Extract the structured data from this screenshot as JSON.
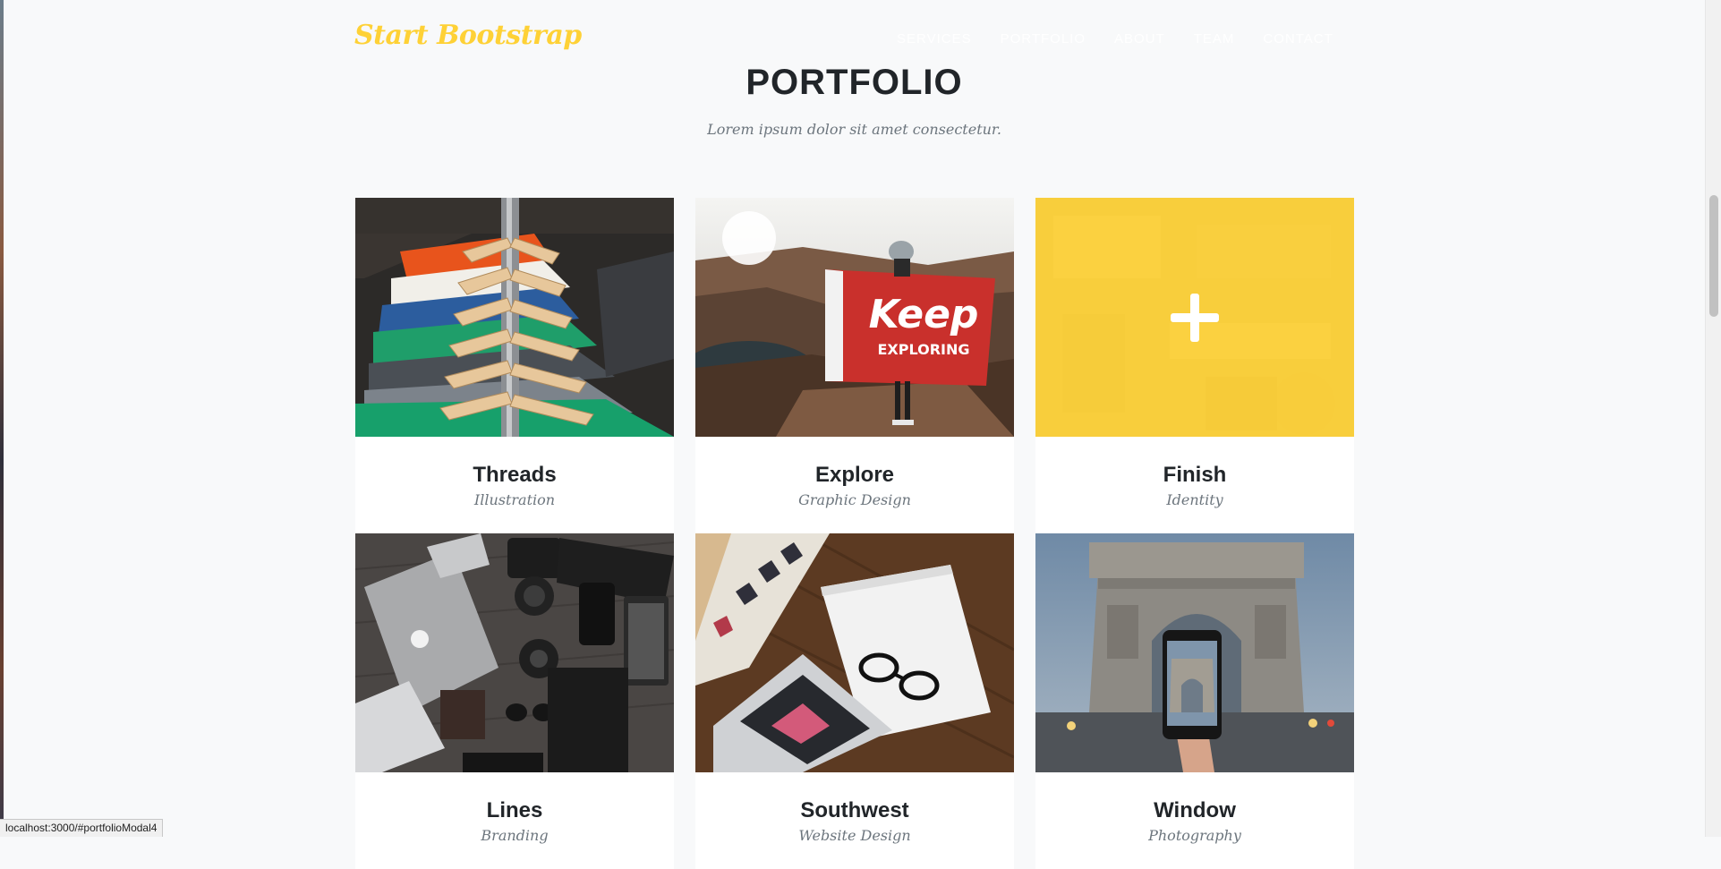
{
  "navbar": {
    "brand": "Start Bootstrap",
    "links": [
      {
        "label": "Services"
      },
      {
        "label": "Portfolio"
      },
      {
        "label": "About"
      },
      {
        "label": "Team"
      },
      {
        "label": "Contact"
      }
    ]
  },
  "portfolio": {
    "title": "PORTFOLIO",
    "subtitle": "Lorem ipsum dolor sit amet consectetur.",
    "items": [
      {
        "title": "Threads",
        "category": "Illustration",
        "image": "clothes-hangers-photo"
      },
      {
        "title": "Explore",
        "category": "Graphic Design",
        "image": "keep-exploring-flag-photo"
      },
      {
        "title": "Finish",
        "category": "Identity",
        "image": "desk-items-photo",
        "hovered": true
      },
      {
        "title": "Lines",
        "category": "Branding",
        "image": "laptop-camera-flatlay-photo"
      },
      {
        "title": "Southwest",
        "category": "Website Design",
        "image": "laptop-glasses-desk-photo"
      },
      {
        "title": "Window",
        "category": "Photography",
        "image": "arc-de-triomphe-phone-photo"
      }
    ]
  },
  "status_bar": {
    "url": "localhost:3000/#portfolioModal4"
  },
  "colors": {
    "accent": "#fed136",
    "text_dark": "#212529",
    "text_muted": "#6c757d",
    "background": "#f8f9fa"
  }
}
